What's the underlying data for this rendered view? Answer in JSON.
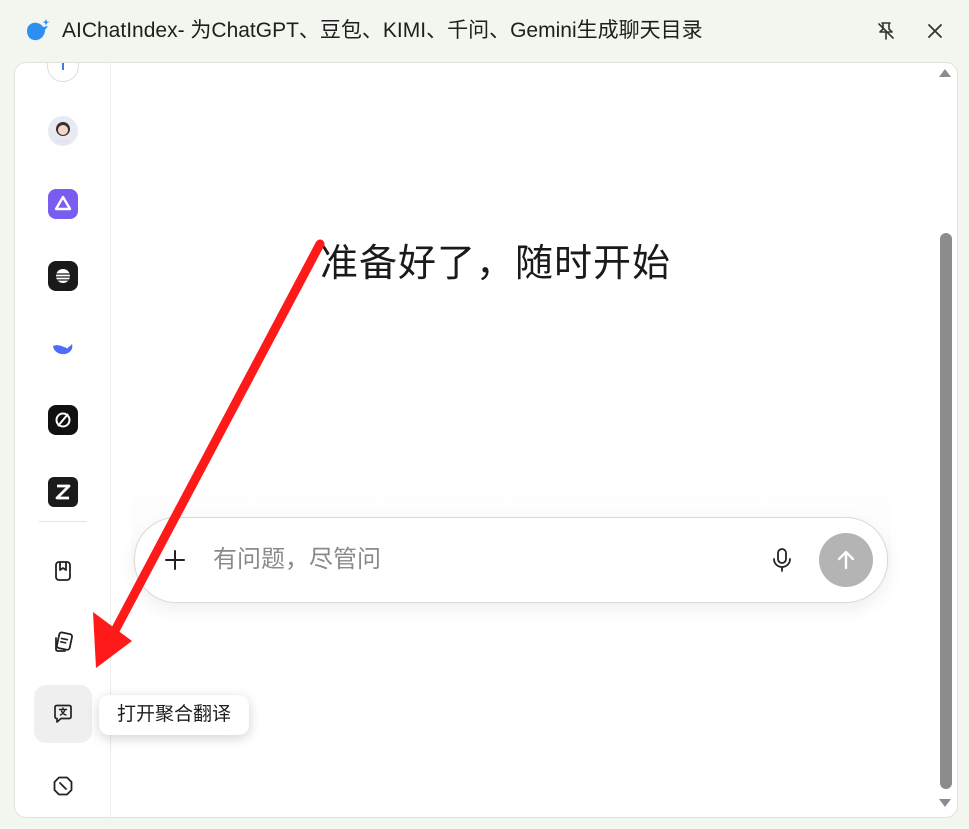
{
  "window": {
    "title": "AIChatIndex- 为ChatGPT、豆包、KIMI、千问、Gemini生成聊天目录",
    "icons": {
      "app": "bird-logo-icon",
      "pin": "unpin-icon",
      "close": "close-icon"
    }
  },
  "sidebar": {
    "items": [
      {
        "name": "partial-top-app-icon"
      },
      {
        "name": "avatar-app-icon"
      },
      {
        "name": "purple-app-icon"
      },
      {
        "name": "dark-sphere-app-icon"
      },
      {
        "name": "whale-app-icon"
      },
      {
        "name": "slashed-circle-app-icon"
      },
      {
        "name": "z-app-icon"
      },
      {
        "name": "bookmark-icon"
      },
      {
        "name": "cards-icon"
      },
      {
        "name": "translate-icon"
      },
      {
        "name": "compass-icon"
      }
    ],
    "active_tooltip": "打开聚合翻译"
  },
  "main": {
    "headline": "准备好了，随时开始",
    "composer": {
      "placeholder": "有问题，尽管问",
      "value": ""
    }
  },
  "colors": {
    "window_bg": "#f3f6ee",
    "send_button": "#b4b4b4",
    "annotation_arrow": "#ff1a1a",
    "purple_app": "#7b5cf0",
    "whale_app": "#4d6bfe"
  }
}
